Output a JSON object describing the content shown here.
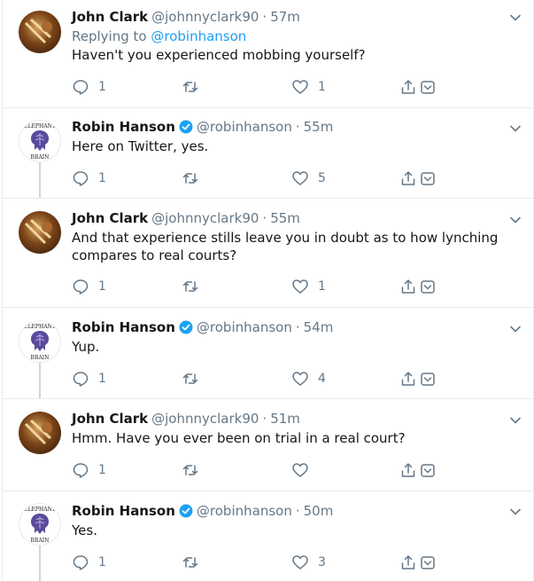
{
  "tweets": [
    {
      "author": "John Clark",
      "handle": "@johnnyclark90",
      "time": "57m",
      "replying_prefix": "Replying to",
      "replying_to": "@robinhanson",
      "text": "Haven't you experienced mobbing yourself?",
      "replies": "1",
      "retweets": "",
      "likes": "1"
    },
    {
      "author": "Robin Hanson",
      "handle": "@robinhanson",
      "time": "55m",
      "text": "Here on Twitter, yes.",
      "replies": "1",
      "retweets": "",
      "likes": "5"
    },
    {
      "author": "John Clark",
      "handle": "@johnnyclark90",
      "time": "55m",
      "text": "And that experience stills leave you in doubt as to how lynching compares to real courts?",
      "replies": "1",
      "retweets": "",
      "likes": "1"
    },
    {
      "author": "Robin Hanson",
      "handle": "@robinhanson",
      "time": "54m",
      "text": "Yup.",
      "replies": "1",
      "retweets": "",
      "likes": "4"
    },
    {
      "author": "John Clark",
      "handle": "@johnnyclark90",
      "time": "51m",
      "text": "Hmm. Have you ever been on trial in a real court?",
      "replies": "1",
      "retweets": "",
      "likes": ""
    },
    {
      "author": "Robin Hanson",
      "handle": "@robinhanson",
      "time": "50m",
      "text": "Yes.",
      "replies": "1",
      "retweets": "",
      "likes": "3"
    }
  ],
  "avatar_logo": {
    "top_text": "ELEPHANT",
    "bottom_text": "BRAIN"
  },
  "colors": {
    "text": "#14171a",
    "muted": "#657786",
    "link": "#1da1f2",
    "border": "#e6ecf0",
    "verified": "#1da1f2"
  },
  "icons": [
    "reply-icon",
    "retweet-icon",
    "like-icon",
    "share-icon",
    "dm-icon",
    "chevron-down-icon",
    "verified-badge-icon"
  ]
}
